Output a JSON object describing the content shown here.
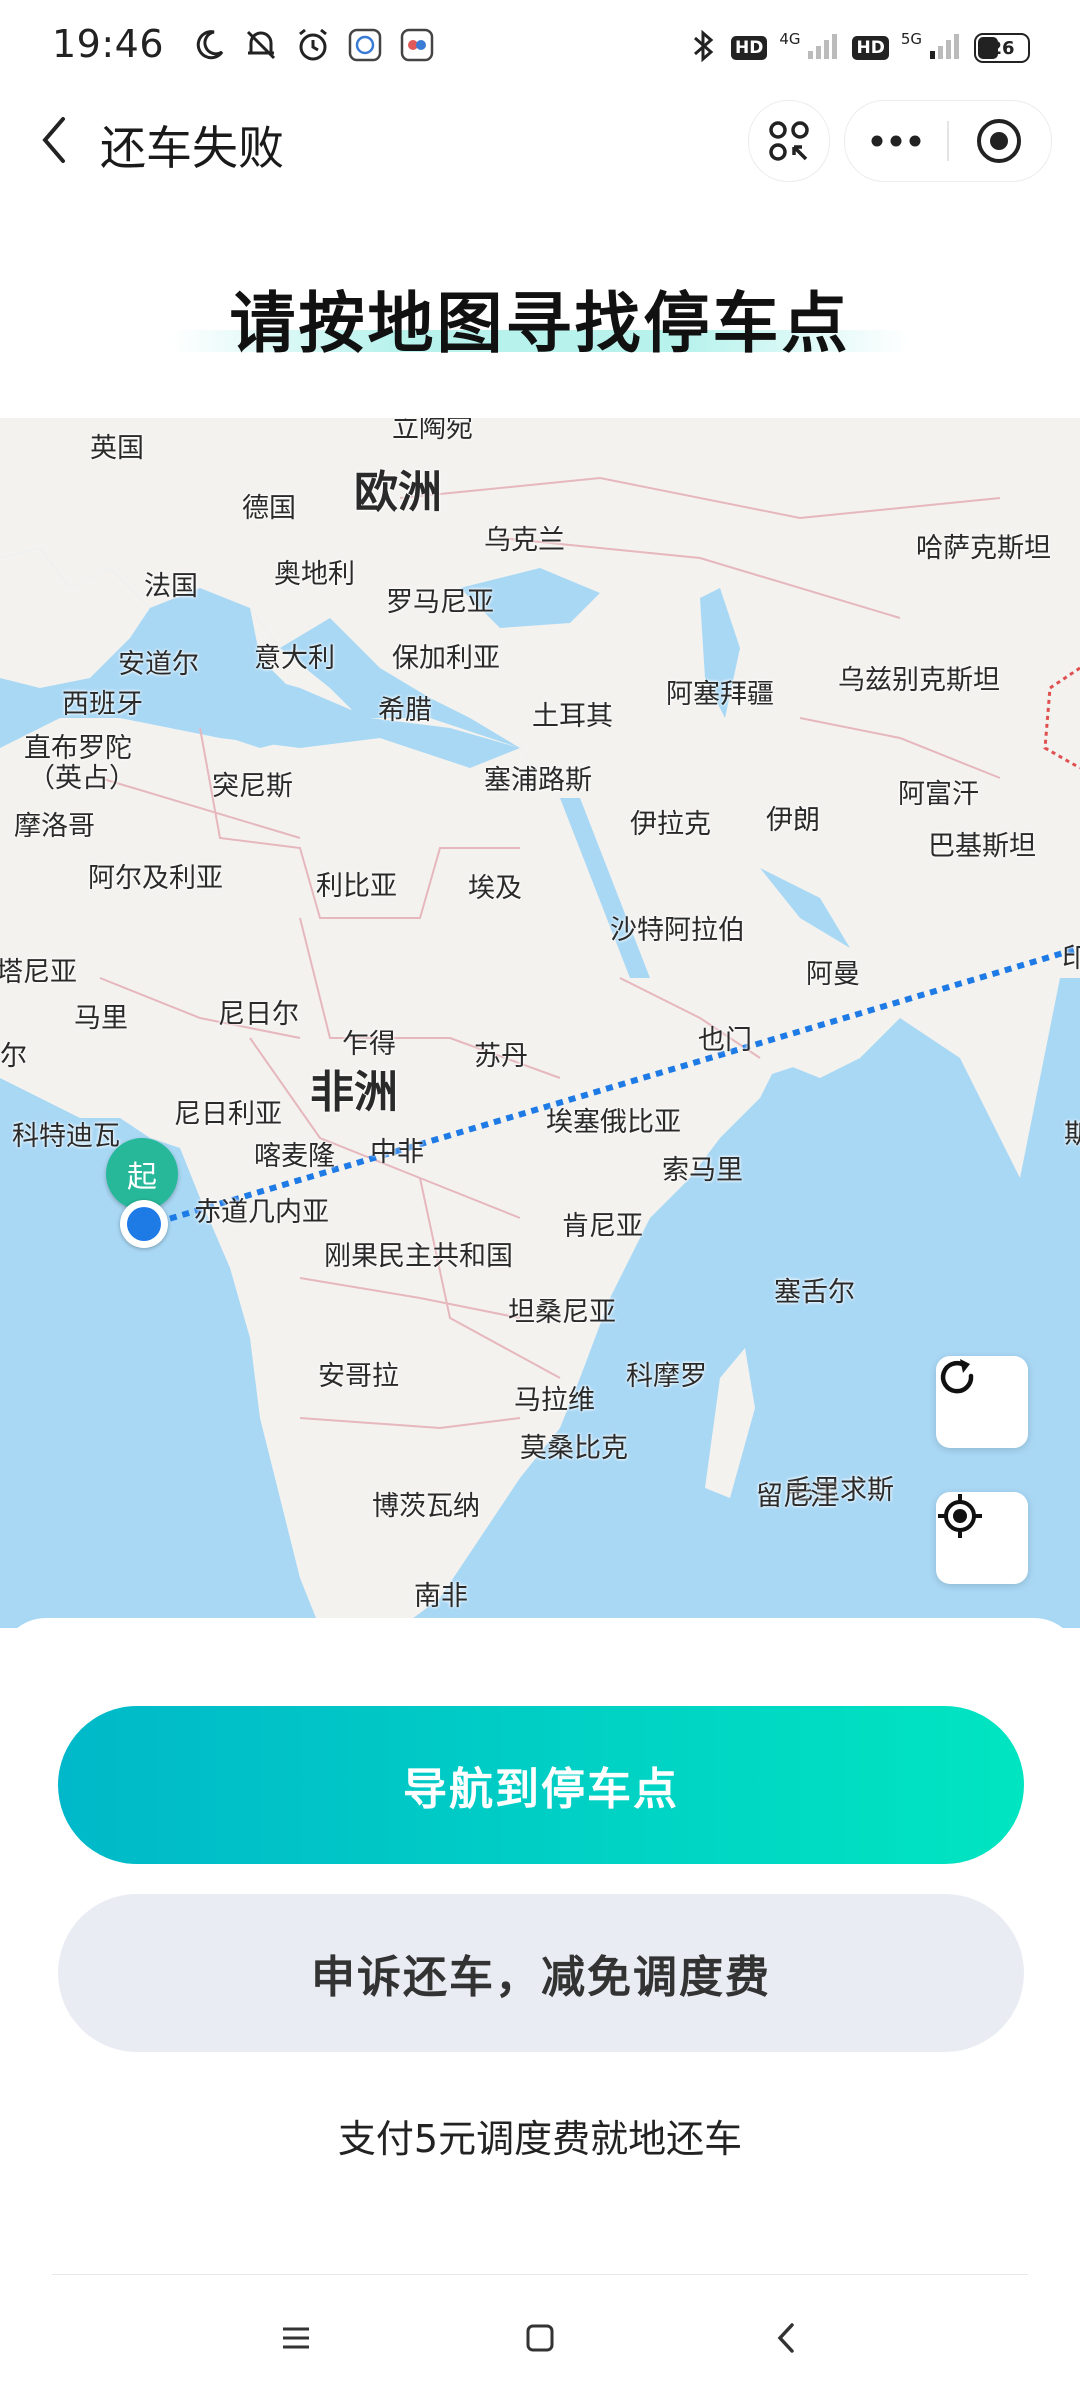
{
  "status_bar": {
    "time": "19:46",
    "left_icons": [
      "moon-icon",
      "mute-bell-icon",
      "alarm-icon",
      "app-notification-icon",
      "app-notification-icon-2"
    ],
    "right_icons": [
      "bluetooth-icon",
      "hd-badge",
      "signal-4g-icon",
      "hd-badge",
      "signal-5g-icon"
    ],
    "hd_label": "HD",
    "net1": "4G",
    "net2": "5G",
    "battery": "26"
  },
  "header": {
    "title": "还车失败"
  },
  "heading": "请按地图寻找停车点",
  "map": {
    "labels": {
      "lithuania": "立陶宛",
      "uk": "英国",
      "europe": "欧洲",
      "germany": "德国",
      "ukraine": "乌克兰",
      "kazakhstan": "哈萨克斯坦",
      "france": "法国",
      "austria": "奥地利",
      "romania": "罗马尼亚",
      "andorra": "安道尔",
      "italy": "意大利",
      "bulgaria": "保加利亚",
      "azerbaijan": "阿塞拜疆",
      "uzbekistan": "乌兹别克斯坦",
      "spain": "西班牙",
      "greece": "希腊",
      "turkey": "土耳其",
      "gibraltar_1": "直布罗陀",
      "gibraltar_2": "（英占）",
      "tunisia": "突尼斯",
      "cyprus": "塞浦路斯",
      "iraq": "伊拉克",
      "iran": "伊朗",
      "afghanistan": "阿富汗",
      "morocco": "摩洛哥",
      "pakistan": "巴基斯坦",
      "algeria": "阿尔及利亚",
      "libya": "利比亚",
      "egypt": "埃及",
      "saudi": "沙特阿拉伯",
      "mauritania": "塔尼亚",
      "oman": "阿曼",
      "mali": "马里",
      "niger": "尼日尔",
      "india": "印",
      "yemen": "也门",
      "chad": "乍得",
      "sudan": "苏丹",
      "senegal": "尔",
      "africa": "非洲",
      "nigeria": "尼日利亚",
      "ethiopia": "埃塞俄比亚",
      "cote": "科特迪瓦",
      "cameroon": "喀麦隆",
      "car": "中非",
      "somalia": "索马里",
      "eq_guinea": "赤道几内亚",
      "kenya": "肯尼亚",
      "drc": "刚果民主共和国",
      "seychelles": "塞舌尔",
      "tanzania": "坦桑尼亚",
      "angola": "安哥拉",
      "malawi": "马拉维",
      "comoros": "科摩罗",
      "mozambique": "莫桑比克",
      "mauritius": "毛里求斯",
      "reunion": "留尼汪",
      "botswana": "博茨瓦纳",
      "south_africa": "南非",
      "sri": "斯"
    },
    "start_pin": "起"
  },
  "actions": {
    "navigate": "导航到停车点",
    "appeal": "申诉还车，减免调度费",
    "pay": "支付5元调度费就地还车"
  },
  "colors": {
    "accent_start": "#00b8c9",
    "accent_end": "#00e5c1",
    "pin": "#27b89a",
    "route": "#1e7be6",
    "ocean": "#a9d8f5",
    "land": "#f3f2ef"
  }
}
